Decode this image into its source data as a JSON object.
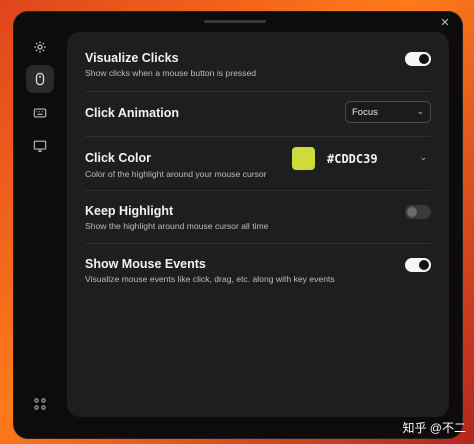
{
  "window": {
    "close_icon": "x-icon"
  },
  "sidebar": {
    "items": [
      {
        "icon": "gear-icon",
        "active": false
      },
      {
        "icon": "mouse-icon",
        "active": true
      },
      {
        "icon": "keyboard-icon",
        "active": false
      },
      {
        "icon": "monitor-icon",
        "active": false
      }
    ],
    "bottom_icon": "grid-icon"
  },
  "settings": {
    "visualize_clicks": {
      "title": "Visualize Clicks",
      "desc": "Show clicks when a mouse button is pressed",
      "enabled": true
    },
    "click_animation": {
      "title": "Click Animation",
      "selected": "Focus"
    },
    "click_color": {
      "title": "Click Color",
      "desc": "Color of the highlight around your mouse cursor",
      "hex": "#CDDC39",
      "swatch": "#CDDC39"
    },
    "keep_highlight": {
      "title": "Keep Highlight",
      "desc": "Show the highlight around mouse cursor all time",
      "enabled": false
    },
    "show_mouse_events": {
      "title": "Show Mouse Events",
      "desc": "Visualize mouse events like click, drag, etc. along with key events",
      "enabled": true
    }
  },
  "watermark": "知乎 @不二"
}
